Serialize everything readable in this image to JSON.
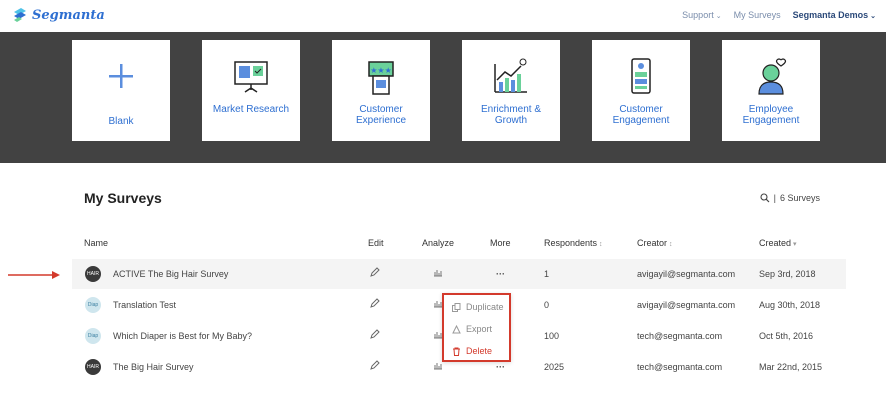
{
  "header": {
    "logo_text": "Segmanta",
    "support": "Support",
    "my_surveys": "My Surveys",
    "account": "Segmanta Demos"
  },
  "templates": [
    {
      "label": "Blank",
      "icon": "plus-icon"
    },
    {
      "label": "Market Research",
      "icon": "presentation-board-icon"
    },
    {
      "label": "Customer Experience",
      "icon": "star-rating-phone-icon"
    },
    {
      "label": "Enrichment & Growth",
      "icon": "growth-chart-icon"
    },
    {
      "label": "Customer Engagement",
      "icon": "phone-engagement-icon"
    },
    {
      "label": "Employee Engagement",
      "icon": "employee-heart-icon"
    }
  ],
  "surveys": {
    "title": "My Surveys",
    "count_label": "6 Surveys",
    "columns": {
      "name": "Name",
      "edit": "Edit",
      "analyze": "Analyze",
      "more": "More",
      "respondents": "Respondents",
      "creator": "Creator",
      "created": "Created"
    },
    "rows": [
      {
        "name": "ACTIVE The Big Hair Survey",
        "respondents": "1",
        "creator": "avigayil@segmanta.com",
        "created": "Sep 3rd, 2018",
        "avatar": "hair",
        "highlighted": true
      },
      {
        "name": "Translation Test",
        "respondents": "0",
        "creator": "avigayil@segmanta.com",
        "created": "Aug 30th, 2018",
        "avatar": "diaper",
        "highlighted": false
      },
      {
        "name": "Which Diaper is Best for My Baby?",
        "respondents": "100",
        "creator": "tech@segmanta.com",
        "created": "Oct 5th, 2016",
        "avatar": "diaper",
        "highlighted": false
      },
      {
        "name": "The Big Hair Survey",
        "respondents": "2025",
        "creator": "tech@segmanta.com",
        "created": "Mar 22nd, 2015",
        "avatar": "hair",
        "highlighted": false
      }
    ]
  },
  "more_menu": {
    "duplicate": "Duplicate",
    "export": "Export",
    "delete": "Delete"
  },
  "colors": {
    "accent": "#2e6fd1",
    "band": "#424242",
    "annotation": "#d33a2c"
  }
}
